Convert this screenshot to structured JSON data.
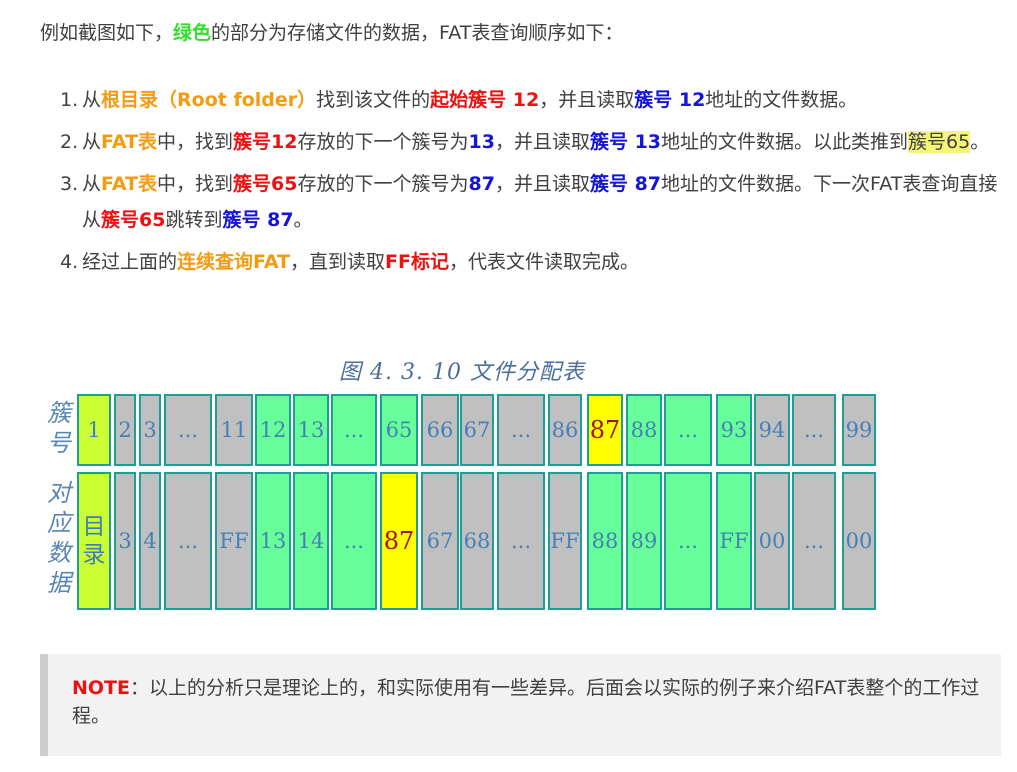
{
  "intro": {
    "before": "例如截图如下，",
    "green": "绿色",
    "after": "的部分为存储文件的数据，FAT表查询顺序如下："
  },
  "steps": [
    {
      "num": "1.",
      "parts": [
        {
          "t": "从",
          "c": ""
        },
        {
          "t": "根目录（Root folder）",
          "c": "o"
        },
        {
          "t": "找到该文件的",
          "c": ""
        },
        {
          "t": "起始簇号 12",
          "c": "r"
        },
        {
          "t": "，并且读取",
          "c": ""
        },
        {
          "t": "簇号 12",
          "c": "b"
        },
        {
          "t": "地址的文件数据。",
          "c": ""
        }
      ]
    },
    {
      "num": "2.",
      "parts": [
        {
          "t": "从",
          "c": ""
        },
        {
          "t": "FAT表",
          "c": "o"
        },
        {
          "t": "中，找到",
          "c": ""
        },
        {
          "t": "簇号12",
          "c": "r"
        },
        {
          "t": "存放的下一个簇号为",
          "c": ""
        },
        {
          "t": "13",
          "c": "b"
        },
        {
          "t": "，并且读取",
          "c": ""
        },
        {
          "t": "簇号 13",
          "c": "b"
        },
        {
          "t": "地址的文件数据。以此类推到",
          "c": ""
        },
        {
          "t": "簇号65",
          "c": "hl"
        },
        {
          "t": "。",
          "c": ""
        }
      ]
    },
    {
      "num": "3.",
      "parts": [
        {
          "t": "从",
          "c": ""
        },
        {
          "t": "FAT表",
          "c": "o"
        },
        {
          "t": "中，找到",
          "c": ""
        },
        {
          "t": "簇号65",
          "c": "r"
        },
        {
          "t": "存放的下一个簇号为",
          "c": ""
        },
        {
          "t": "87",
          "c": "b"
        },
        {
          "t": "，并且读取",
          "c": ""
        },
        {
          "t": "簇号 87",
          "c": "b"
        },
        {
          "t": "地址的文件数据。下一次FAT表查询直接从",
          "c": ""
        },
        {
          "t": "簇号65",
          "c": "r"
        },
        {
          "t": "跳转到",
          "c": ""
        },
        {
          "t": "簇号 87",
          "c": "b"
        },
        {
          "t": "。",
          "c": ""
        }
      ]
    },
    {
      "num": "4.",
      "parts": [
        {
          "t": "经过上面的",
          "c": ""
        },
        {
          "t": "连续查询FAT",
          "c": "o"
        },
        {
          "t": "，直到读取",
          "c": ""
        },
        {
          "t": "FF标记",
          "c": "r"
        },
        {
          "t": "，代表文件读取完成。",
          "c": ""
        }
      ]
    }
  ],
  "figure": {
    "caption": "图 4. 3. 10  文件分配表",
    "row1_label": [
      "簇",
      "号"
    ],
    "row2_label": [
      "对",
      "应",
      "数",
      "据"
    ],
    "clusters": [
      {
        "top": "1",
        "bottom": [
          "目",
          "录"
        ],
        "topColor": "lime",
        "bottomColor": "lime"
      },
      {
        "top": "2",
        "bottom": "3",
        "topColor": "grey",
        "bottomColor": "grey"
      },
      {
        "top": "3",
        "bottom": "4",
        "topColor": "grey",
        "bottomColor": "grey"
      },
      {
        "top": "...",
        "bottom": "...",
        "topColor": "grey",
        "bottomColor": "grey"
      },
      {
        "top": "11",
        "bottom": "FF",
        "topColor": "grey",
        "bottomColor": "grey"
      },
      {
        "top": "12",
        "bottom": "13",
        "topColor": "green",
        "bottomColor": "green"
      },
      {
        "top": "13",
        "bottom": "14",
        "topColor": "green",
        "bottomColor": "green"
      },
      {
        "top": "...",
        "bottom": "...",
        "topColor": "green",
        "bottomColor": "green"
      },
      {
        "top": "65",
        "bottom": "87",
        "topColor": "green",
        "bottomColor": "yellow"
      },
      {
        "top": "66",
        "bottom": "67",
        "topColor": "grey",
        "bottomColor": "grey"
      },
      {
        "top": "67",
        "bottom": "68",
        "topColor": "grey",
        "bottomColor": "grey"
      },
      {
        "top": "...",
        "bottom": "...",
        "topColor": "grey",
        "bottomColor": "grey"
      },
      {
        "top": "86",
        "bottom": "FF",
        "topColor": "grey",
        "bottomColor": "grey"
      },
      {
        "top": "87",
        "bottom": "88",
        "topColor": "yellow",
        "bottomColor": "green"
      },
      {
        "top": "88",
        "bottom": "89",
        "topColor": "green",
        "bottomColor": "green"
      },
      {
        "top": "...",
        "bottom": "...",
        "topColor": "green",
        "bottomColor": "green"
      },
      {
        "top": "93",
        "bottom": "FF",
        "topColor": "green",
        "bottomColor": "green"
      },
      {
        "top": "94",
        "bottom": "00",
        "topColor": "grey",
        "bottomColor": "grey"
      },
      {
        "top": "...",
        "bottom": "...",
        "topColor": "grey",
        "bottomColor": "grey"
      },
      {
        "top": "99",
        "bottom": "00",
        "topColor": "grey",
        "bottomColor": "grey"
      }
    ]
  },
  "note": {
    "label": "NOTE",
    "text": "：以上的分析只是理论上的，和实际使用有一些差异。后面会以实际的例子来介绍FAT表整个的工作过程。"
  }
}
